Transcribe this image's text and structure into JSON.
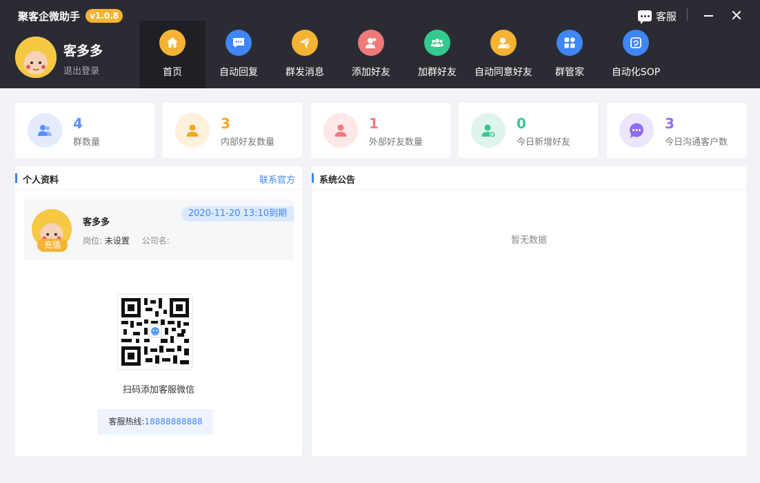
{
  "app": {
    "title": "聚客企微助手",
    "version": "v1.0.8"
  },
  "header": {
    "customer_service": "客服"
  },
  "user": {
    "name": "客多多",
    "logout": "退出登录"
  },
  "nav": [
    {
      "label": "首页",
      "icon": "home-icon",
      "color": "#f5b334",
      "active": true
    },
    {
      "label": "自动回复",
      "icon": "chat-icon",
      "color": "#3f86f6"
    },
    {
      "label": "群发消息",
      "icon": "send-icon",
      "color": "#f5b334"
    },
    {
      "label": "添加好友",
      "icon": "add-user-icon",
      "color": "#ef7a78"
    },
    {
      "label": "加群好友",
      "icon": "group-icon",
      "color": "#34c98e"
    },
    {
      "label": "自动同意好友",
      "icon": "approve-user-icon",
      "color": "#f5b334"
    },
    {
      "label": "群管家",
      "icon": "apps-icon",
      "color": "#3f86f6"
    },
    {
      "label": "自动化SOP",
      "icon": "automation-icon",
      "color": "#3f86f6"
    }
  ],
  "stats": [
    {
      "value": "4",
      "label": "群数量",
      "color": "#5b8ef6",
      "bg": "#e3ebfd",
      "icon": "group-icon"
    },
    {
      "value": "3",
      "label": "内部好友数量",
      "color": "#f5a623",
      "bg": "#fdf1dc",
      "icon": "person-icon"
    },
    {
      "value": "1",
      "label": "外部好友数量",
      "color": "#ee7b7b",
      "bg": "#fde7e7",
      "icon": "person-icon"
    },
    {
      "value": "0",
      "label": "今日新增好友",
      "color": "#3cc593",
      "bg": "#dff5ec",
      "icon": "add-person-icon"
    },
    {
      "value": "3",
      "label": "今日沟通客户数",
      "color": "#8d6cf0",
      "bg": "#ece6fc",
      "icon": "message-icon"
    }
  ],
  "profile": {
    "title": "个人资料",
    "contact_link": "联系官方",
    "name": "客多多",
    "expiry": "2020-11-20 13:10到期",
    "recharge": "充值",
    "position_label": "岗位:",
    "position_value": "未设置",
    "company_label": "公司名:",
    "company_value": "",
    "qr_caption": "扫码添加客服微信",
    "hotline_label": "客服热线:",
    "hotline_number": "18888888888"
  },
  "notice": {
    "title": "系统公告",
    "empty": "暂无数据"
  }
}
